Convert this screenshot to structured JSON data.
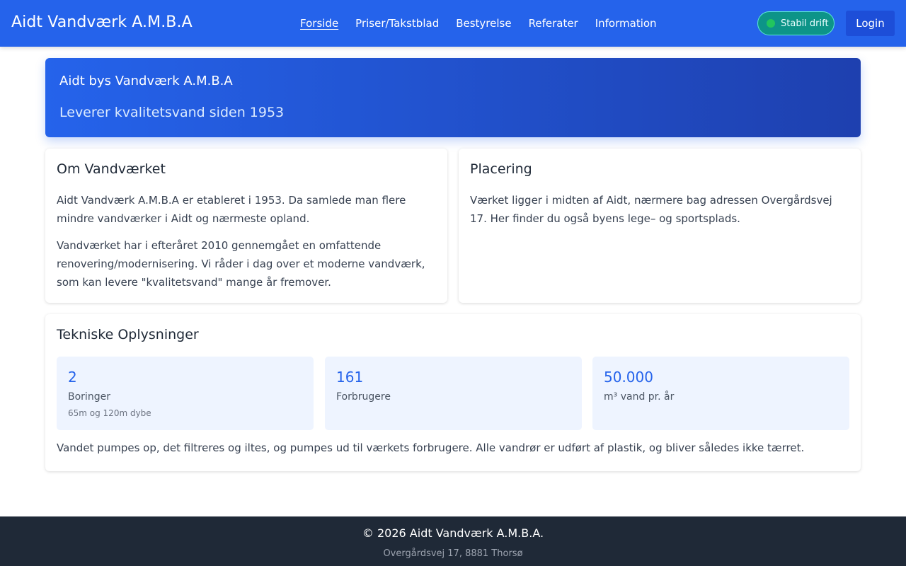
{
  "header": {
    "brand": "Aidt Vandværk A.M.B.A",
    "nav": [
      {
        "label": "Forside",
        "active": true
      },
      {
        "label": "Priser/Takstblad"
      },
      {
        "label": "Bestyrelse"
      },
      {
        "label": "Referater"
      },
      {
        "label": "Information"
      }
    ],
    "status": {
      "label": "Stabil drift",
      "dot_color": "#22c55e"
    },
    "login_label": "Login"
  },
  "hero": {
    "title": "Aidt bys Vandværk A.M.B.A",
    "subtitle": "Leverer kvalitetsvand siden 1953"
  },
  "about": {
    "title": "Om Vandværket",
    "paragraphs": [
      "Aidt Vandværk A.M.B.A er etableret i 1953. Da samlede man flere mindre vandværker i Aidt og nærmeste opland.",
      "Vandværket har i efteråret 2010 gennemgået en omfattende renovering/modernisering. Vi råder i dag over et moderne vandværk, som kan levere \"kvalitetsvand\" mange år fremover."
    ]
  },
  "placement": {
    "title": "Placering",
    "text": "Værket ligger i midten af Aidt, nærmere bag adressen Overgårdsvej 17. Her finder du også byens lege– og sportsplads."
  },
  "technical": {
    "title": "Tekniske Oplysninger",
    "stats": [
      {
        "value": "2",
        "label": "Boringer",
        "note": "65m og 120m dybe"
      },
      {
        "value": "161",
        "label": "Forbrugere",
        "note": ""
      },
      {
        "value": "50.000",
        "label": "m³ vand pr. år",
        "note": ""
      }
    ],
    "text": "Vandet pumpes op, det filtreres og iltes, og pumpes ud til værkets forbrugere. Alle vandrør er udført af plastik, og bliver således ikke tærret."
  },
  "footer": {
    "copyright": "© 2026 Aidt Vandværk A.M.B.A.",
    "address": "Overgårdsvej 17, 8881 Thorsø"
  },
  "colors": {
    "primary": "#2563eb",
    "primary_dark": "#1e40af",
    "footer_bg": "#1f2937",
    "stat_bg": "#eef4ff"
  }
}
